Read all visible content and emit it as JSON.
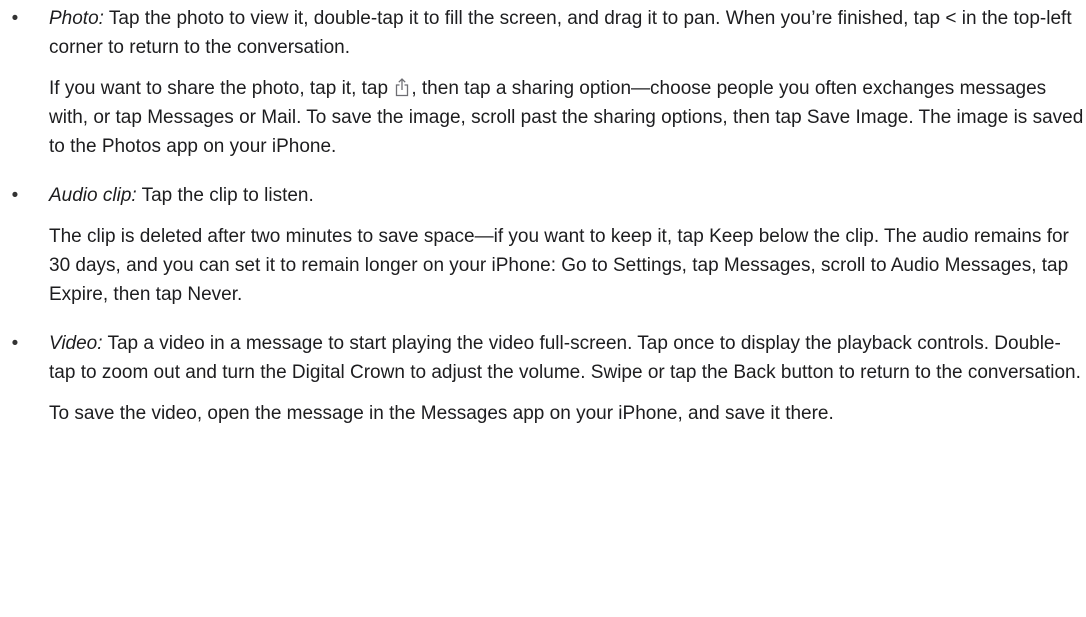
{
  "items": [
    {
      "bullet": "•",
      "term": "Photo:",
      "para1_text": " Tap the photo to view it, double-tap it to fill the screen, and drag it to pan. When you’re finished, tap < in the top-left corner to return to the conversation.",
      "para2_before_icon": "If you want to share the photo, tap it, tap ",
      "share_icon": "share-icon",
      "para2_after_icon": ", then tap a sharing option—choose people you often exchanges messages with, or tap Messages or Mail. To save the image, scroll past the sharing options, then tap Save Image. The image is saved to the Photos app on your iPhone."
    },
    {
      "bullet": "•",
      "term": "Audio clip:",
      "para1_text": " Tap the clip to listen.",
      "para2_text": "The clip is deleted after two minutes to save space—if you want to keep it, tap Keep below the clip. The audio remains for 30 days, and you can set it to remain longer on your iPhone: Go to Settings, tap Messages, scroll to Audio Messages, tap Expire, then tap Never."
    },
    {
      "bullet": "•",
      "term": "Video:",
      "para1_text": " Tap a video in a message to start playing the video full-screen. Tap once to display the playback controls. Double-tap to zoom out and turn the Digital Crown to adjust the volume. Swipe or tap the Back button to return to the conversation.",
      "para2_text": "To save the video, open the message in the Messages app on your iPhone, and save it there."
    }
  ]
}
